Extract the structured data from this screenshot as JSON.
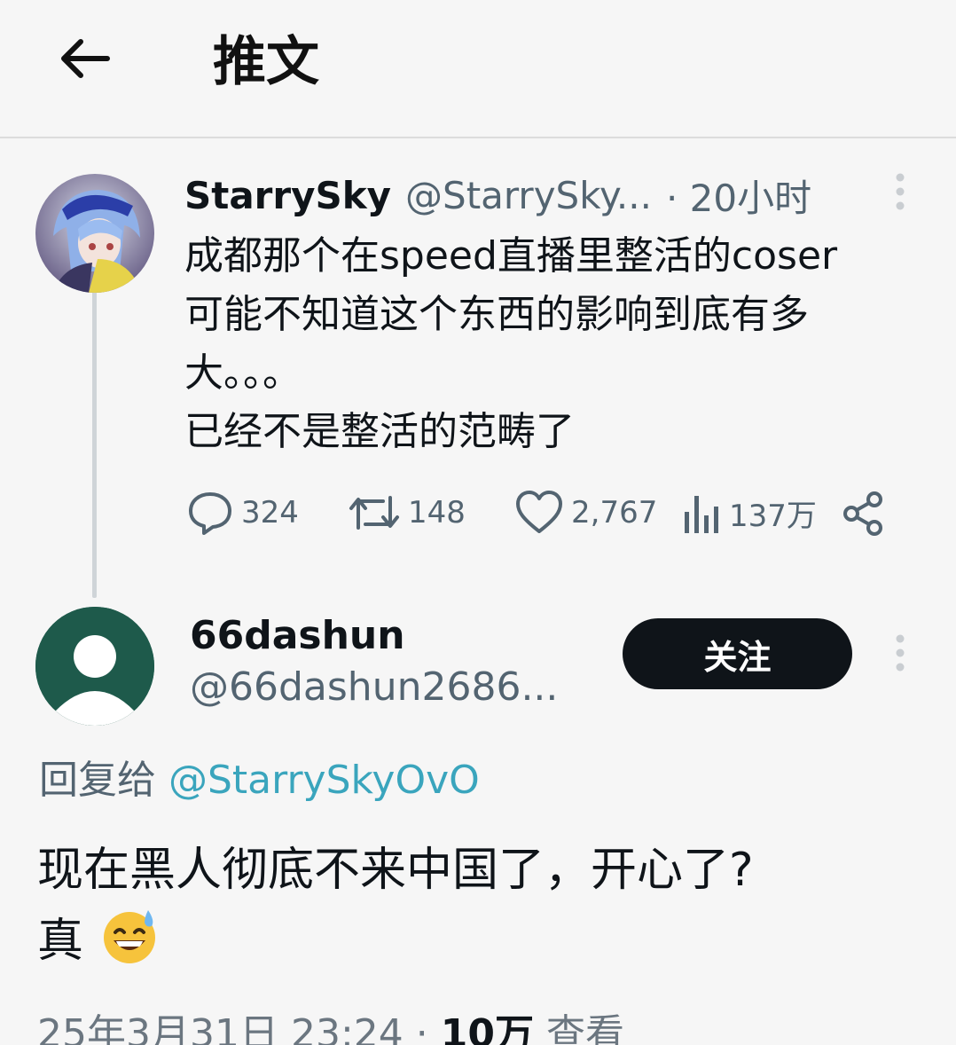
{
  "header": {
    "title": "推文",
    "back_icon": "arrow-left-icon"
  },
  "tweet": {
    "display_name": "StarrySky",
    "handle": "@StarrySky...",
    "time": "· 20小时",
    "lines": [
      "成都那个在speed直播里整活的coser",
      "可能不知道这个东西的影响到底有多",
      "大。。。",
      "已经不是整活的范畴了"
    ],
    "stats": {
      "replies": "324",
      "retweets": "148",
      "likes": "2,767",
      "views": "137万"
    }
  },
  "reply": {
    "display_name": "66dashun",
    "handle": "@66dashun2686...",
    "follow_label": "关注",
    "reply_to_prefix": "回复给 ",
    "reply_to_mention": "@StarrySkyOvO",
    "text_line1": "现在黑人彻底不来中国了，开心了?",
    "text_line2": "真",
    "emoji": "grinning-sweat-emoji",
    "meta_date": "25年3月31日  23:24 · ",
    "meta_views_count": "10万",
    "meta_views_label": " 查看"
  },
  "colors": {
    "background": "#f6f6f6",
    "text_primary": "#0f1419",
    "text_secondary": "#536471",
    "mention": "#3aa5bd",
    "follow_button": "#0f1419",
    "default_avatar": "#1e5a4b"
  }
}
